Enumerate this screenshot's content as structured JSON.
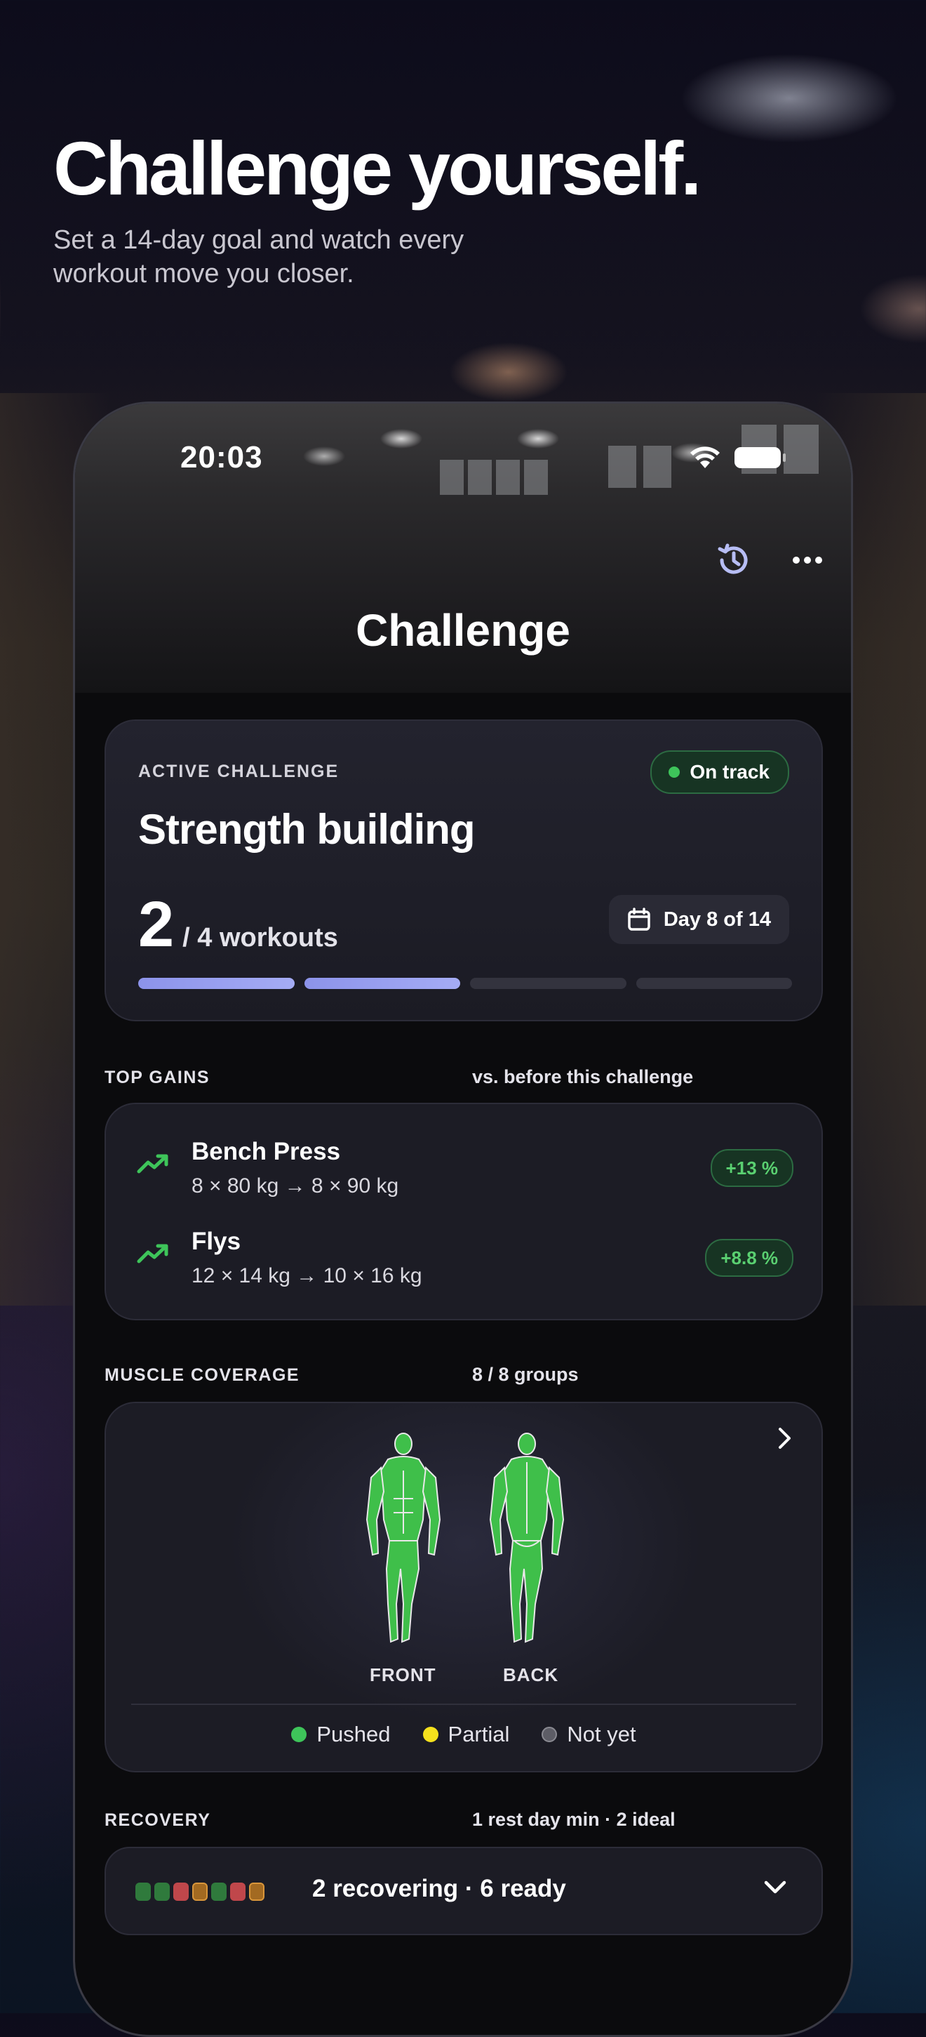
{
  "marketing": {
    "headline": "Challenge yourself.",
    "subtitle": "Set a 14-day goal and watch every workout move you closer."
  },
  "status_bar": {
    "time": "20:03"
  },
  "nav": {
    "title": "Challenge",
    "history_icon": "history-icon",
    "more_icon": "more-icon"
  },
  "active_challenge": {
    "eyebrow": "ACTIVE CHALLENGE",
    "status": "On track",
    "status_color": "#3ec45a",
    "name": "Strength building",
    "completed": "2",
    "target_label": "/ 4 workouts",
    "day_label": "Day 8 of 14",
    "progress_completed": 2,
    "progress_total": 4,
    "progress_color": "#9aa1f0"
  },
  "top_gains": {
    "label": "TOP GAINS",
    "note": "vs. before this challenge",
    "items": [
      {
        "name": "Bench Press",
        "detail": "8 × 80 kg → 8 × 90 kg",
        "change": "+13 %"
      },
      {
        "name": "Flys",
        "detail": "12 × 14 kg → 10 × 16 kg",
        "change": "+8.8 %"
      }
    ]
  },
  "muscle_coverage": {
    "label": "MUSCLE COVERAGE",
    "note": "8 / 8 groups",
    "front_label": "FRONT",
    "back_label": "BACK",
    "legend": [
      {
        "label": "Pushed",
        "color": "#3ec45a"
      },
      {
        "label": "Partial",
        "color": "#f5e11d"
      },
      {
        "label": "Not yet",
        "color": "#5d5d66"
      }
    ]
  },
  "recovery": {
    "label": "RECOVERY",
    "note": "1 rest day min · 2 ideal",
    "summary": "2 recovering · 6 ready",
    "squares": [
      "#2f7a3c",
      "#2f7a3c",
      "#c0474b",
      "#a36a21",
      "#2f7a3c",
      "#c0474b",
      "#a36a21"
    ]
  }
}
